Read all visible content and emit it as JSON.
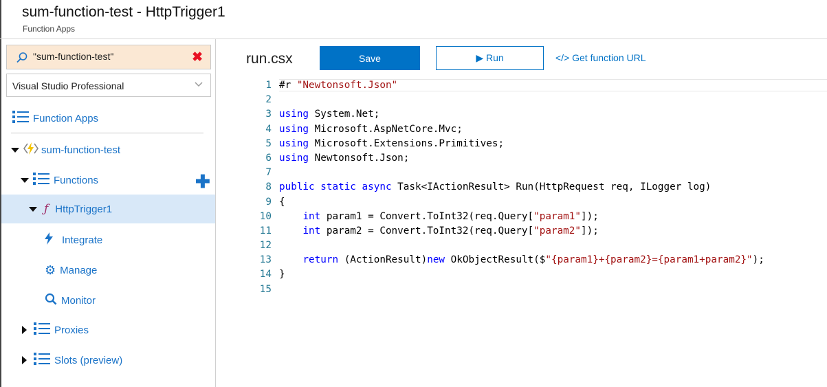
{
  "header": {
    "title": "sum-function-test - HttpTrigger1",
    "subtitle": "Function Apps"
  },
  "sidebar": {
    "search_value": "\"sum-function-test\"",
    "subscription": "Visual Studio Professional",
    "function_apps_label": "Function Apps",
    "app_name": "sum-function-test",
    "functions_label": "Functions",
    "function_name": "HttpTrigger1",
    "integrate_label": "Integrate",
    "manage_label": "Manage",
    "monitor_label": "Monitor",
    "proxies_label": "Proxies",
    "slots_label": "Slots (preview)"
  },
  "toolbar": {
    "filename": "run.csx",
    "save_label": "Save",
    "run_label": "Run",
    "get_url_label": "</> Get function URL"
  },
  "editor": {
    "lines": [
      "#r \"Newtonsoft.Json\"",
      "",
      "using System.Net;",
      "using Microsoft.AspNetCore.Mvc;",
      "using Microsoft.Extensions.Primitives;",
      "using Newtonsoft.Json;",
      "",
      "public static async Task<IActionResult> Run(HttpRequest req, ILogger log)",
      "{",
      "    int param1 = Convert.ToInt32(req.Query[\"param1\"]);",
      "    int param2 = Convert.ToInt32(req.Query[\"param2\"]);",
      "",
      "    return (ActionResult)new OkObjectResult($\"{param1}+{param2}={param1+param2}\");",
      "}",
      ""
    ]
  },
  "colors": {
    "accent": "#0072c6",
    "link": "#1a73c8",
    "selected_bg": "#d8e8f8",
    "search_bg": "#fbe8d4",
    "keyword": "#0000ff",
    "string": "#a31515",
    "line_number": "#237893"
  }
}
